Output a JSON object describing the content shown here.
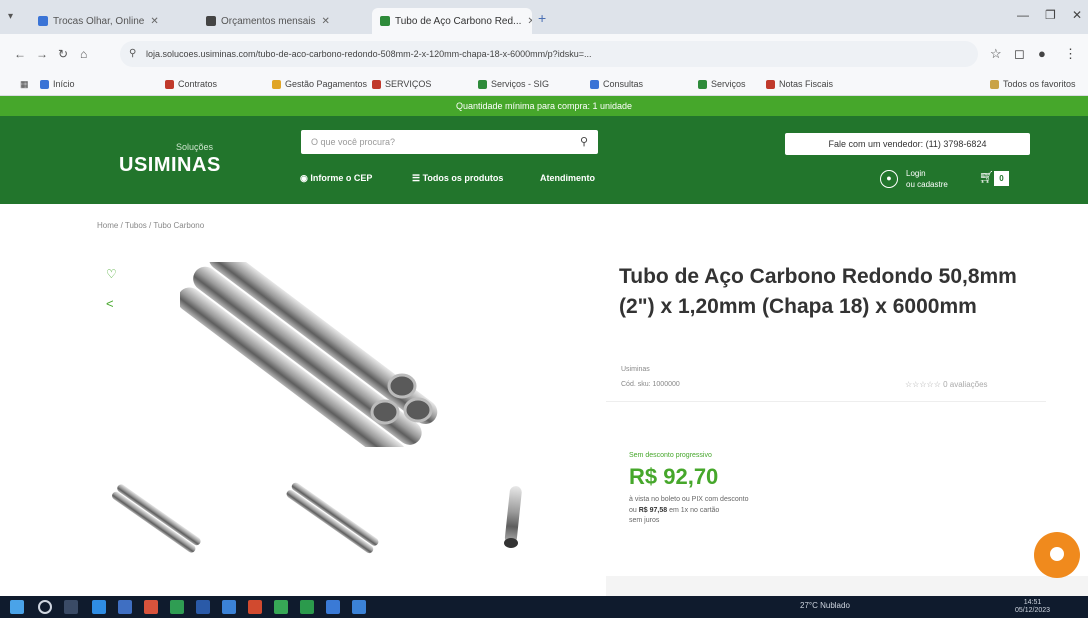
{
  "browser": {
    "tabs": [
      {
        "label": "Trocas Olhar, Online",
        "favicon_color": "#3b74d6"
      },
      {
        "label": "Orçamentos mensais",
        "favicon_color": "#444444"
      },
      {
        "label": "Tubo de Aço Carbono Red...",
        "favicon_color": "#2e8b3a"
      }
    ],
    "url": "loja.solucoes.usiminas.com/tubo-de-aco-carbono-redondo-508mm-2-x-120mm-chapa-18-x-6000mm/p?idsku=...",
    "bookmarks": [
      {
        "label": "Início",
        "color": "#3b74d6"
      },
      {
        "label": "Contratos",
        "color": "#c0392b"
      },
      {
        "label": "Gestão Pagamentos",
        "color": "#e0a526"
      },
      {
        "label": "SERVIÇOS",
        "color": "#c0392b"
      },
      {
        "label": "Serviços - SIG",
        "color": "#2e8b3a"
      },
      {
        "label": "Consultas",
        "color": "#3b74d6"
      },
      {
        "label": "Serviços",
        "color": "#2e8b3a"
      },
      {
        "label": "Notas Fiscais",
        "color": "#c0392b"
      }
    ],
    "bookmarks_right": "Todos os favoritos"
  },
  "promo": {
    "text": "Quantidade mínima para compra: 1 unidade"
  },
  "header": {
    "logo_sub": "Soluções",
    "logo": "USIMINAS",
    "search_placeholder": "O que você procura?",
    "nav": [
      "Informe o CEP",
      "Todos os produtos",
      "Atendimento"
    ],
    "seller_button": "Fale com um vendedor: (11) 3798-6824",
    "login_line1": "Login",
    "login_line2": "ou cadastre",
    "cart_count": "0"
  },
  "breadcrumb": "Home / Tubos / Tubo Carbono",
  "product": {
    "title": "Tubo de Aço Carbono Redondo 50,8mm (2\") x 1,20mm (Chapa 18) x 6000mm",
    "brand": "Usiminas",
    "sku": "Cód. sku: 1000000",
    "rating_text": "☆☆☆☆☆ 0 avaliações",
    "price_note": "Sem desconto progressivo",
    "price": "R$ 92,70",
    "price_pix": "à vista no boleto ou PIX com desconto",
    "price_old_prefix": "ou",
    "price_old": "R$ 97,58",
    "price_old_suffix": "em 1x no cartão",
    "price_installments": "sem juros"
  },
  "taskbar": {
    "tray": "27°C Nublado",
    "time": "14:51",
    "date": "05/12/2023"
  }
}
